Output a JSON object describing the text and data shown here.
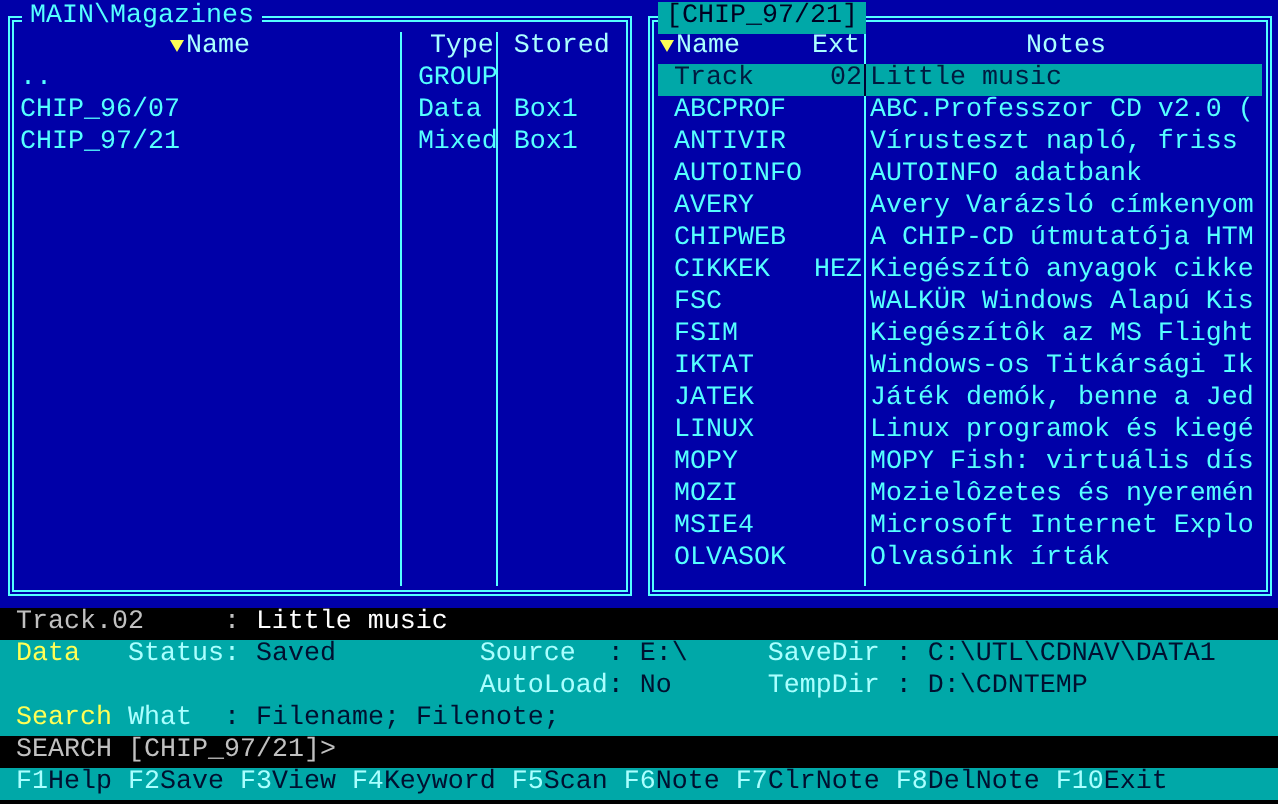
{
  "left_panel": {
    "title": "MAIN\\Magazines",
    "columns": [
      {
        "label": "Name",
        "sorted": true
      },
      {
        "label": "Type",
        "sorted": false
      },
      {
        "label": "Stored",
        "sorted": false
      }
    ],
    "rows": [
      {
        "name": "..",
        "type": "GROUP"
      },
      {
        "name": "CHIP_96/07",
        "type": "Data",
        "stored": "Box1"
      },
      {
        "name": "CHIP_97/21",
        "type": "Mixed",
        "stored": "Box1"
      }
    ]
  },
  "right_panel": {
    "title": "[CHIP_97/21]",
    "columns": [
      {
        "label": "Name",
        "sorted": true
      },
      {
        "label": "Ext",
        "sorted": false
      },
      {
        "label": "Notes",
        "sorted": false
      }
    ],
    "rows": [
      {
        "name": "Track",
        "ext": "02",
        "notes": "Little music",
        "selected": true
      },
      {
        "name": "ABCPROF",
        "notes": "ABC.Professzor CD v2.0 (",
        "selected": false
      },
      {
        "name": "ANTIVIR",
        "notes": "Vírusteszt napló, friss",
        "selected": false
      },
      {
        "name": "AUTOINFO",
        "notes": "AUTOINFO adatbank",
        "selected": false
      },
      {
        "name": "AVERY",
        "notes": "Avery Varázsló címkenyom",
        "selected": false
      },
      {
        "name": "CHIPWEB",
        "notes": "A CHIP-CD útmutatója HTM",
        "selected": false
      },
      {
        "name": "CIKKEK",
        "ext": "HEZ",
        "notes": "Kiegészítô anyagok cikke",
        "selected": false
      },
      {
        "name": "FSC",
        "notes": "WALKÜR Windows Alapú Kis",
        "selected": false
      },
      {
        "name": "FSIM",
        "notes": "Kiegészítôk az MS Flight",
        "selected": false
      },
      {
        "name": "IKTAT",
        "notes": "Windows-os Titkársági Ik",
        "selected": false
      },
      {
        "name": "JATEK",
        "notes": "Játék demók, benne a Jed",
        "selected": false
      },
      {
        "name": "LINUX",
        "notes": "Linux programok és kiegé",
        "selected": false
      },
      {
        "name": "MOPY",
        "notes": "MOPY Fish: virtuális dís",
        "selected": false
      },
      {
        "name": "MOZI",
        "notes": "Mozielôzetes és nyeremén",
        "selected": false
      },
      {
        "name": "MSIE4",
        "notes": "Microsoft Internet Explo",
        "selected": false
      },
      {
        "name": "OLVASOK",
        "notes": "Olvasóink írták",
        "selected": false
      }
    ]
  },
  "info_line": {
    "label": "Track.02",
    "separator": ":",
    "value": "Little music"
  },
  "settings": {
    "data_label": "Data",
    "status": {
      "label": "Status:",
      "value": "Saved"
    },
    "source": {
      "label": "Source",
      "value": ": E:\\"
    },
    "savedir": {
      "label": "SaveDir",
      "value": ": C:\\UTL\\CDNAV\\DATA1"
    },
    "autoload": {
      "label": "AutoLoad",
      "value": ": No"
    },
    "tempdir": {
      "label": "TempDir",
      "value": ": D:\\CDNTEMP"
    },
    "search_label": "Search",
    "what": {
      "label": "What",
      "value": ": Filename; Filenote;"
    }
  },
  "prompt": "SEARCH [CHIP_97/21]>",
  "function_keys": [
    {
      "key": "F1",
      "label": "Help"
    },
    {
      "key": "F2",
      "label": "Save"
    },
    {
      "key": "F3",
      "label": "View"
    },
    {
      "key": "F4",
      "label": "Keyword"
    },
    {
      "key": "F5",
      "label": "Scan"
    },
    {
      "key": "F6",
      "label": "Note"
    },
    {
      "key": "F7",
      "label": "ClrNote"
    },
    {
      "key": "F8",
      "label": "DelNote"
    },
    {
      "key": "F10",
      "label": "Exit"
    }
  ]
}
